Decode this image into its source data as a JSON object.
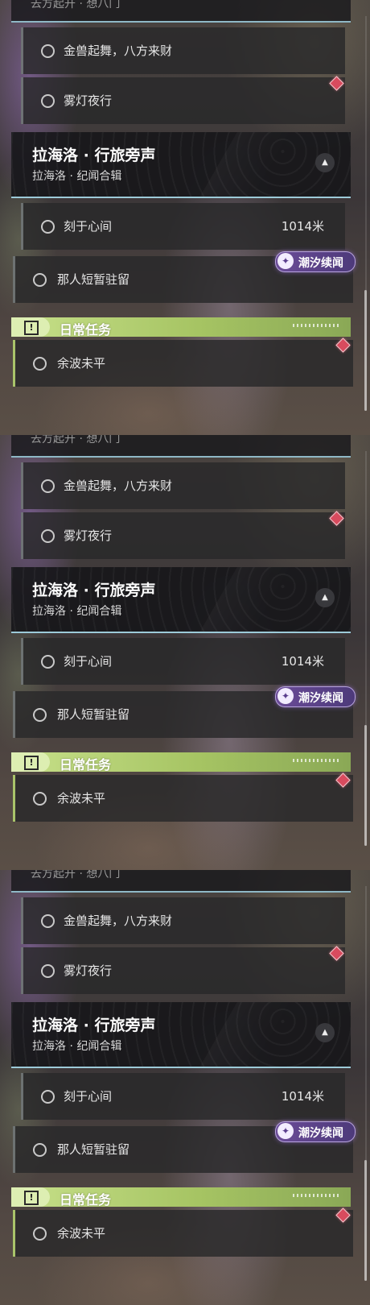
{
  "panels": [
    {
      "top_partial": "去方起开 · 想八门",
      "quests_a": [
        "金兽起舞，八方来财",
        "雾灯夜行"
      ],
      "region": {
        "title": "拉海洛 · 行旅旁声",
        "subtitle": "拉海洛 · 纪闻合辑",
        "collapse_icon": "▲"
      },
      "quest_distance": {
        "label": "刻于心间",
        "distance": "1014米"
      },
      "quest_featured": "那人短暂驻留",
      "badge": {
        "icon": "✦",
        "label": "潮汐续闻"
      },
      "daily": {
        "label": "日常任务",
        "icon": "!"
      },
      "daily_quest": "余波未平"
    },
    {
      "top_partial": "去方起开 · 想八门",
      "quests_a": [
        "金兽起舞，八方来财",
        "雾灯夜行"
      ],
      "region": {
        "title": "拉海洛 · 行旅旁声",
        "subtitle": "拉海洛 · 纪闻合辑",
        "collapse_icon": "▲"
      },
      "quest_distance": {
        "label": "刻于心间",
        "distance": "1014米"
      },
      "quest_featured": "那人短暂驻留",
      "badge": {
        "icon": "✦",
        "label": "潮汐续闻"
      },
      "daily": {
        "label": "日常任务",
        "icon": "!"
      },
      "daily_quest": "余波未平"
    },
    {
      "top_partial": "去方起开 · 想八门",
      "quests_a": [
        "金兽起舞，八方来财",
        "雾灯夜行"
      ],
      "region": {
        "title": "拉海洛 · 行旅旁声",
        "subtitle": "拉海洛 · 纪闻合辑",
        "collapse_icon": "▲"
      },
      "quest_distance": {
        "label": "刻于心间",
        "distance": "1014米"
      },
      "quest_featured": "那人短暂驻留",
      "badge": {
        "icon": "✦",
        "label": "潮汐续闻"
      },
      "daily": {
        "label": "日常任务",
        "icon": "!"
      },
      "daily_quest": "余波未平"
    }
  ],
  "colors": {
    "accent_line": "#9ccad8",
    "daily_green": "#a6c463",
    "badge_purple": "#6a4b97",
    "marker_red": "#d84b5e"
  }
}
